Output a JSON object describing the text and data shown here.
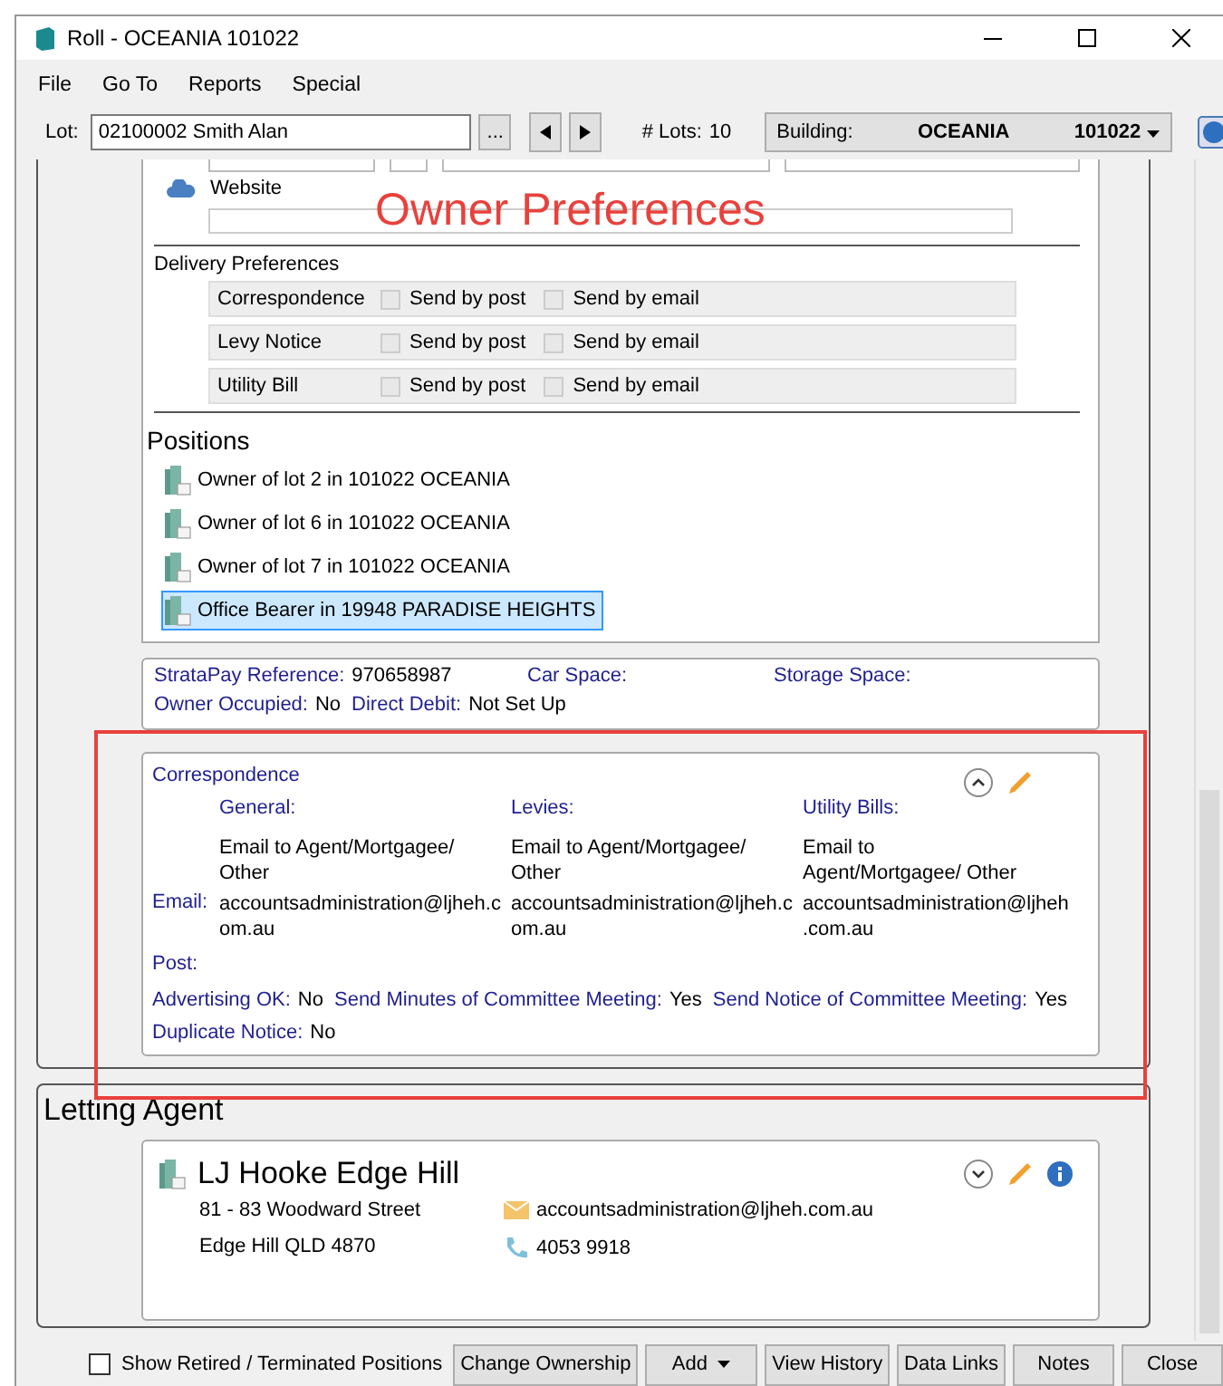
{
  "window": {
    "title": "Roll - OCEANIA 101022"
  },
  "menu": [
    "File",
    "Go To",
    "Reports",
    "Special"
  ],
  "toolbar": {
    "lot_label": "Lot:",
    "lot_value": "02100002 Smith Alan",
    "browse_button": "...",
    "lots_label": "# Lots:",
    "lots_value": "10",
    "building_label": "Building:",
    "building_name": "OCEANIA",
    "building_number": "101022"
  },
  "annotation": {
    "text": "Owner Preferences"
  },
  "contact": {
    "website_label": "Website"
  },
  "delivery_preferences": {
    "title": "Delivery Preferences",
    "rows": [
      {
        "label": "Correspondence",
        "options": [
          {
            "label": "Send by post",
            "checked": false
          },
          {
            "label": "Send by email",
            "checked": false
          }
        ]
      },
      {
        "label": "Levy Notice",
        "options": [
          {
            "label": "Send by post",
            "checked": false
          },
          {
            "label": "Send by email",
            "checked": false
          }
        ]
      },
      {
        "label": "Utility Bill",
        "options": [
          {
            "label": "Send by post",
            "checked": false
          },
          {
            "label": "Send by email",
            "checked": false
          }
        ]
      }
    ]
  },
  "positions": {
    "title": "Positions",
    "items": [
      {
        "label": "Owner of lot 2 in 101022 OCEANIA",
        "selected": false
      },
      {
        "label": "Owner of lot 6 in 101022 OCEANIA",
        "selected": false
      },
      {
        "label": "Owner of lot 7 in 101022 OCEANIA",
        "selected": false
      },
      {
        "label": "Office Bearer in 19948 PARADISE HEIGHTS",
        "selected": true
      }
    ]
  },
  "strata": {
    "rows": [
      [
        {
          "label": "StrataPay Reference:",
          "value": "970658987"
        },
        {
          "label": "Car Space:"
        },
        {
          "label": "Storage Space:"
        }
      ],
      [
        {
          "label": "Owner Occupied:",
          "value": "No"
        },
        {
          "label": "Direct Debit:",
          "value": "Not Set Up"
        }
      ]
    ]
  },
  "correspondence": {
    "title": "Correspondence",
    "email_label": "Email:",
    "post_label": "Post:",
    "columns": [
      {
        "heading": "General:",
        "method": "Email to Agent/Mortgagee/ Other",
        "email": "accountsadministration@ljheh.com.au"
      },
      {
        "heading": "Levies:",
        "method": "Email to Agent/Mortgagee/ Other",
        "email": "accountsadministration@ljheh.com.au"
      },
      {
        "heading": "Utility Bills:",
        "method": "Email to Agent/Mortgagee/ Other",
        "email": "accountsadministration@ljheh.com.au"
      }
    ],
    "flags": [
      [
        {
          "label": "Advertising OK:",
          "value": "No"
        },
        {
          "label": "Send Minutes of Committee Meeting:",
          "value": "Yes"
        },
        {
          "label": "Send Notice of Committee Meeting:",
          "value": "Yes"
        }
      ],
      [
        {
          "label": "Duplicate Notice:",
          "value": "No"
        }
      ]
    ]
  },
  "letting_agent": {
    "title": "Letting Agent",
    "name": "LJ Hooke Edge Hill",
    "address": [
      "81 - 83 Woodward Street",
      "Edge Hill QLD 4870"
    ],
    "email": "accountsadministration@ljheh.com.au",
    "phone": "4053 9918"
  },
  "footer": {
    "show_retired": {
      "label": "Show Retired / Terminated Positions",
      "checked": false
    },
    "buttons": [
      {
        "label": "Change Ownership",
        "kind": "plain"
      },
      {
        "label": "Add",
        "kind": "dropdown"
      },
      {
        "label": "View History",
        "kind": "plain"
      },
      {
        "label": "Data Links",
        "kind": "plain"
      },
      {
        "label": "Notes",
        "kind": "plain"
      },
      {
        "label": "Close",
        "kind": "plain"
      }
    ]
  }
}
